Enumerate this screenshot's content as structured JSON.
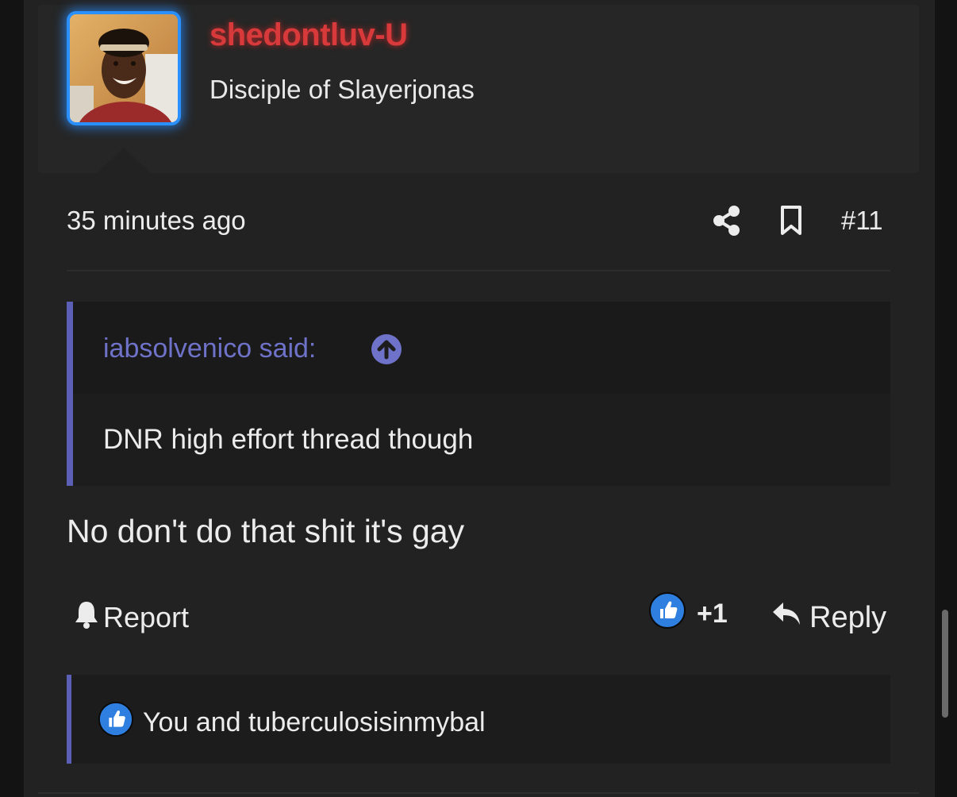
{
  "user": {
    "username": "shedontluv-U",
    "title": "Disciple of Slayerjonas",
    "avatar_alt": "user avatar"
  },
  "post": {
    "time": "35 minutes ago",
    "number": "#11",
    "quote": {
      "author": "iabsolvenico said:",
      "text": "DNR high effort thread though"
    },
    "body": "No don't do that shit it's gay"
  },
  "actions": {
    "report_label": "Report",
    "like_count": "+1",
    "reply_label": "Reply"
  },
  "reactions": {
    "text": "You and tuberculosisinmybal"
  },
  "icons": {
    "share": "share-icon",
    "bookmark": "bookmark-icon",
    "quote_jump": "arrow-up-circle-icon",
    "report": "bell-icon",
    "like": "thumbs-up-icon",
    "reply": "reply-arrow-icon"
  },
  "colors": {
    "username": "#d8393a",
    "avatar_border": "#2a90ff",
    "quote_accent": "#5b5fb6",
    "like_badge": "#2e7fe0"
  }
}
